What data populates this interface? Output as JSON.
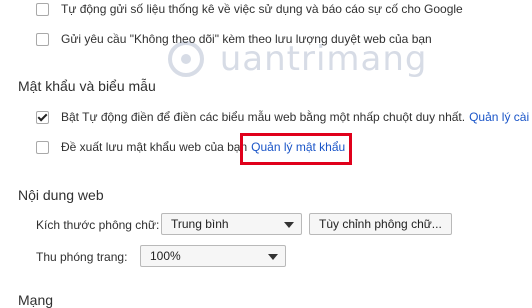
{
  "privacy": {
    "items": [
      {
        "label": "Tự động gửi số liệu thống kê về việc sử dụng và báo cáo sự cố cho Google",
        "checked": false
      },
      {
        "label": "Gửi yêu cầu \"Không theo dõi\" kèm theo lưu lượng duyệt web của bạn",
        "checked": false
      }
    ]
  },
  "passwords": {
    "heading": "Mật khẩu và biểu mẫu",
    "autofill_label": "Bật Tự động điền để điền các biểu mẫu web bằng một nhấp chuột duy nhất.",
    "autofill_link": "Quản lý cài đ",
    "autofill_checked": true,
    "save_label": "Đề xuất lưu mật khẩu web của bạn",
    "save_link": "Quản lý mật khẩu",
    "save_checked": false
  },
  "web_content": {
    "heading": "Nội dung web",
    "font_size_label": "Kích thước phông chữ:",
    "font_size_value": "Trung bình",
    "customize_fonts_button": "Tùy chỉnh phông chữ...",
    "zoom_label": "Thu phóng trang:",
    "zoom_value": "100%"
  },
  "network": {
    "heading": "Mạng"
  },
  "watermark": "Quantrimang",
  "colors": {
    "link": "#1a55c8",
    "highlight_box": "#e0001b"
  }
}
